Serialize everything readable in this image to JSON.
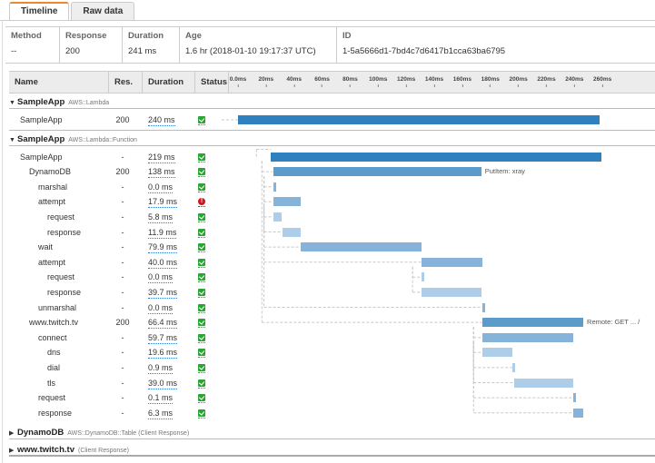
{
  "tabs": [
    {
      "label": "Timeline",
      "active": true
    },
    {
      "label": "Raw data",
      "active": false
    }
  ],
  "summary": [
    {
      "label": "Method",
      "value": "--"
    },
    {
      "label": "Response",
      "value": "200"
    },
    {
      "label": "Duration",
      "value": "241 ms"
    },
    {
      "label": "Age",
      "value": "1.6 hr (2018-01-10 19:17:37 UTC)"
    },
    {
      "label": "ID",
      "value": "1-5a5666d1-7bd4c7d6417b1cca63ba6795"
    }
  ],
  "columns": {
    "name": "Name",
    "res": "Res.",
    "duration": "Duration",
    "status": "Status"
  },
  "ticks": [
    "0.0ms",
    "20ms",
    "40ms",
    "60ms",
    "80ms",
    "100ms",
    "120ms",
    "140ms",
    "160ms",
    "180ms",
    "200ms",
    "220ms",
    "240ms",
    "260ms"
  ],
  "colors": {
    "dark": "#2f80bf",
    "mid": "#5b9ccb",
    "light": "#85b3d9",
    "lighter": "#aecde8",
    "ok": "#2aa534",
    "error": "#d1141e",
    "accent": "#e88a2c"
  },
  "groups": [
    {
      "name": "SampleApp",
      "type": "AWS::Lambda",
      "expanded": true
    },
    {
      "name": "SampleApp",
      "type": "AWS::Lambda::Function",
      "expanded": true
    },
    {
      "name": "DynamoDB",
      "type": "AWS::DynamoDB::Table (Client Response)",
      "expanded": false
    },
    {
      "name": "www.twitch.tv",
      "type": "(Client Response)",
      "expanded": false
    }
  ],
  "segments": [
    {
      "group": 0,
      "name": "SampleApp",
      "depth": 0,
      "res": "200",
      "duration": "240 ms",
      "status": "ok",
      "start_ms": 0.0,
      "dur_ms": 258.0,
      "shade": "dark",
      "label": ""
    },
    {
      "group": 1,
      "name": "SampleApp",
      "depth": 0,
      "res": "-",
      "duration": "219 ms",
      "status": "ok",
      "start_ms": 23.5,
      "dur_ms": 235.5,
      "shade": "dark",
      "label": ""
    },
    {
      "group": 1,
      "name": "DynamoDB",
      "depth": 1,
      "res": "200",
      "duration": "138 ms",
      "status": "ok",
      "start_ms": 25.0,
      "dur_ms": 148.5,
      "shade": "mid",
      "label": "PutItem: xray"
    },
    {
      "group": 1,
      "name": "marshal",
      "depth": 2,
      "res": "-",
      "duration": "0.0 ms",
      "status": "ok",
      "start_ms": 25.0,
      "dur_ms": 2.0,
      "shade": "light",
      "label": ""
    },
    {
      "group": 1,
      "name": "attempt",
      "depth": 2,
      "res": "-",
      "duration": "17.9 ms",
      "status": "error",
      "start_ms": 25.0,
      "dur_ms": 19.5,
      "shade": "light",
      "label": ""
    },
    {
      "group": 1,
      "name": "request",
      "depth": 3,
      "res": "-",
      "duration": "5.8 ms",
      "status": "ok",
      "start_ms": 25.0,
      "dur_ms": 6.3,
      "shade": "lighter",
      "label": ""
    },
    {
      "group": 1,
      "name": "response",
      "depth": 3,
      "res": "-",
      "duration": "11.9 ms",
      "status": "ok",
      "start_ms": 31.5,
      "dur_ms": 13.0,
      "shade": "lighter",
      "label": ""
    },
    {
      "group": 1,
      "name": "wait",
      "depth": 2,
      "res": "-",
      "duration": "79.9 ms",
      "status": "ok",
      "start_ms": 44.5,
      "dur_ms": 86.5,
      "shade": "light",
      "label": ""
    },
    {
      "group": 1,
      "name": "attempt",
      "depth": 2,
      "res": "-",
      "duration": "40.0 ms",
      "status": "ok",
      "start_ms": 131.0,
      "dur_ms": 43.3,
      "shade": "light",
      "label": ""
    },
    {
      "group": 1,
      "name": "request",
      "depth": 3,
      "res": "-",
      "duration": "0.0 ms",
      "status": "ok",
      "start_ms": 131.0,
      "dur_ms": 2.0,
      "shade": "lighter",
      "label": ""
    },
    {
      "group": 1,
      "name": "response",
      "depth": 3,
      "res": "-",
      "duration": "39.7 ms",
      "status": "ok",
      "start_ms": 131.0,
      "dur_ms": 43.0,
      "shade": "lighter",
      "label": ""
    },
    {
      "group": 1,
      "name": "unmarshal",
      "depth": 2,
      "res": "-",
      "duration": "0.0 ms",
      "status": "ok",
      "start_ms": 174.3,
      "dur_ms": 2.0,
      "shade": "light",
      "label": ""
    },
    {
      "group": 1,
      "name": "www.twitch.tv",
      "depth": 1,
      "res": "200",
      "duration": "66.4 ms",
      "status": "ok",
      "start_ms": 174.5,
      "dur_ms": 71.8,
      "shade": "mid",
      "label": "Remote: GET ... /"
    },
    {
      "group": 1,
      "name": "connect",
      "depth": 2,
      "res": "-",
      "duration": "59.7 ms",
      "status": "ok",
      "start_ms": 174.5,
      "dur_ms": 64.6,
      "shade": "light",
      "label": ""
    },
    {
      "group": 1,
      "name": "dns",
      "depth": 3,
      "res": "-",
      "duration": "19.6 ms",
      "status": "ok",
      "start_ms": 174.5,
      "dur_ms": 21.2,
      "shade": "lighter",
      "label": ""
    },
    {
      "group": 1,
      "name": "dial",
      "depth": 3,
      "res": "-",
      "duration": "0.9 ms",
      "status": "ok",
      "start_ms": 195.7,
      "dur_ms": 2.0,
      "shade": "lighter",
      "label": ""
    },
    {
      "group": 1,
      "name": "tls",
      "depth": 3,
      "res": "-",
      "duration": "39.0 ms",
      "status": "ok",
      "start_ms": 196.9,
      "dur_ms": 42.2,
      "shade": "lighter",
      "label": ""
    },
    {
      "group": 1,
      "name": "request",
      "depth": 2,
      "res": "-",
      "duration": "0.1 ms",
      "status": "ok",
      "start_ms": 239.3,
      "dur_ms": 2.0,
      "shade": "light",
      "label": ""
    },
    {
      "group": 1,
      "name": "response",
      "depth": 2,
      "res": "-",
      "duration": "6.3 ms",
      "status": "ok",
      "start_ms": 239.3,
      "dur_ms": 6.8,
      "shade": "light",
      "label": ""
    }
  ]
}
